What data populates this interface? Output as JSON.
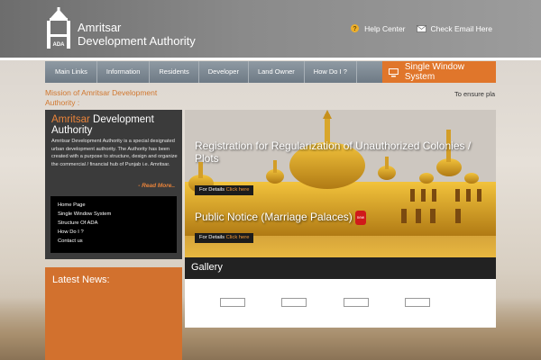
{
  "header": {
    "logo_text": "ADA",
    "brand_line1": "Amritsar",
    "brand_line2": "Development Authority",
    "top_links": [
      {
        "label": "Help Center",
        "icon": "help-icon"
      },
      {
        "label": "Check Email Here",
        "icon": "email-icon"
      }
    ]
  },
  "nav": {
    "items": [
      "Main Links",
      "Information",
      "Residents",
      "Developer",
      "Land Owner",
      "How Do I ?"
    ],
    "single_window": "Single Window System",
    "single_window_icon": "computer-icon"
  },
  "mission": {
    "heading": "Mission of Amritsar Development Authority :",
    "ticker": "To ensure pla"
  },
  "about": {
    "title_accent": "Amritsar",
    "title_rest": "Development Authority",
    "text": "Amritsar Development Authority is a special designated urban development authority. The Authority has been created with a purpose to structure, design and organize the commercial / financial hub of Punjab i.e. Amritsar.",
    "read_more": "- Read More..",
    "links": [
      "Home Page",
      "Single Window System",
      "Structure Of ADA",
      "How Do I ?",
      "Contact us"
    ]
  },
  "slider": {
    "caption1": "Registration for Regularization of Unauthorized Colonies / Plots",
    "caption2": "Public Notice (Marriage Palaces)",
    "new_badge": "new",
    "details_label": "For Details",
    "click_here": "Click here"
  },
  "news": {
    "title": "Latest News:"
  },
  "gallery": {
    "title": "Gallery"
  },
  "colors": {
    "accent": "#e0762b",
    "nav": "#7a858f",
    "dark_panel": "#3b3b3b"
  }
}
